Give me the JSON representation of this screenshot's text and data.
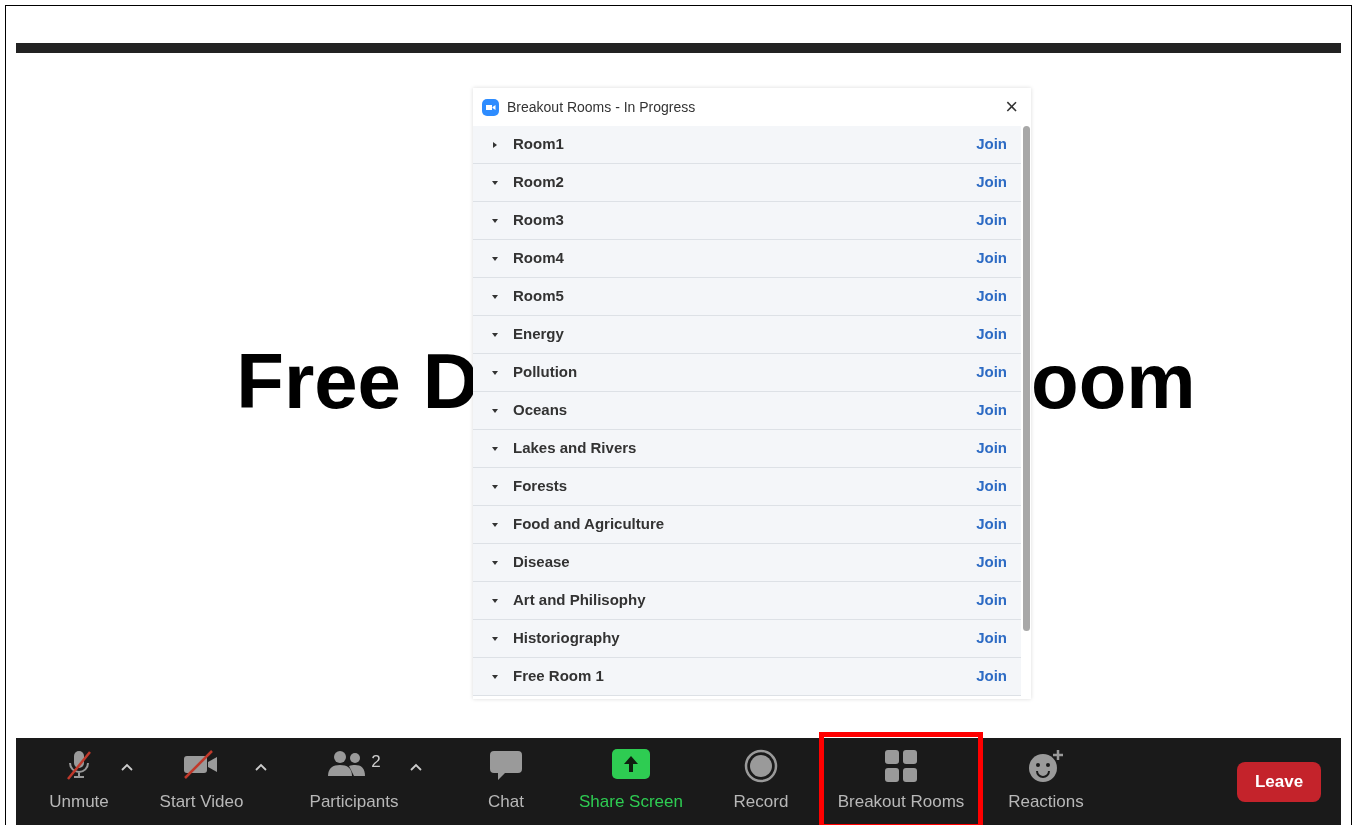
{
  "slide": {
    "title_left": "Free D",
    "title_right": "oom"
  },
  "dialog": {
    "title": "Breakout Rooms - In Progress",
    "close": "×",
    "rooms": [
      {
        "name": "Room1",
        "expanded": false,
        "action": "Join"
      },
      {
        "name": "Room2",
        "expanded": true,
        "action": "Join"
      },
      {
        "name": "Room3",
        "expanded": true,
        "action": "Join"
      },
      {
        "name": "Room4",
        "expanded": true,
        "action": "Join"
      },
      {
        "name": "Room5",
        "expanded": true,
        "action": "Join"
      },
      {
        "name": "Energy",
        "expanded": true,
        "action": "Join"
      },
      {
        "name": "Pollution",
        "expanded": true,
        "action": "Join"
      },
      {
        "name": "Oceans",
        "expanded": true,
        "action": "Join"
      },
      {
        "name": "Lakes and Rivers",
        "expanded": true,
        "action": "Join"
      },
      {
        "name": "Forests",
        "expanded": true,
        "action": "Join"
      },
      {
        "name": "Food and Agriculture",
        "expanded": true,
        "action": "Join"
      },
      {
        "name": "Disease",
        "expanded": true,
        "action": "Join"
      },
      {
        "name": "Art and Philisophy",
        "expanded": true,
        "action": "Join"
      },
      {
        "name": "Historiography",
        "expanded": true,
        "action": "Join"
      },
      {
        "name": "Free Room 1",
        "expanded": true,
        "action": "Join"
      }
    ]
  },
  "toolbar": {
    "items": [
      {
        "kind": "mic",
        "label": "Unmute",
        "caret": true,
        "highlighted": false
      },
      {
        "kind": "video",
        "label": "Start Video",
        "caret": true,
        "highlighted": false
      },
      {
        "kind": "participants",
        "label": "Participants",
        "count": "2",
        "caret": true,
        "highlighted": false
      },
      {
        "kind": "chat",
        "label": "Chat",
        "caret": false,
        "highlighted": false
      },
      {
        "kind": "share",
        "label": "Share Screen",
        "caret": false,
        "highlighted": false
      },
      {
        "kind": "record",
        "label": "Record",
        "caret": false,
        "highlighted": false
      },
      {
        "kind": "breakout",
        "label": "Breakout Rooms",
        "caret": false,
        "highlighted": true
      },
      {
        "kind": "reactions",
        "label": "Reactions",
        "caret": false,
        "highlighted": false
      }
    ],
    "leave": "Leave"
  }
}
